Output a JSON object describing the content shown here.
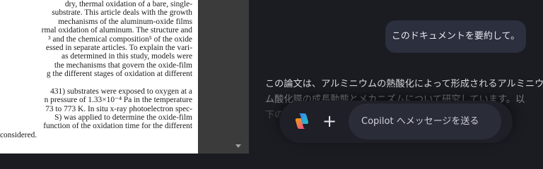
{
  "document": {
    "lines": [
      "dry, thermal oxidation of a bare, single-",
      "substrate. This article deals with the growth",
      "mechanisms of the aluminum-oxide films",
      "rmal oxidation of aluminum. The structure and",
      "³ and the chemical composition⁵ of the oxide",
      "essed in separate articles. To explain the vari-",
      "as determined in this study, models were",
      "the mechanisms that govern the oxide-film",
      "g the different stages of oxidation at different",
      "",
      "431) substrates were exposed to oxygen at a",
      "n pressure of 1.33×10⁻⁴ Pa in the temperature",
      "73 to 773 K. In situ x-ray photoelectron spec-",
      "S) was applied to determine the oxide-film",
      "function of the oxidation time for the different",
      "considered."
    ]
  },
  "chat": {
    "user_message": "このドキュメントを要約して。",
    "reply_lines": [
      "この論文は、アルミニウムの熱酸化によって形成されるアルミニウ",
      "ム酸化膜の成長動態とメカニズムについて研究しています。以",
      "下の"
    ]
  },
  "composer": {
    "placeholder": "Copilot へメッセージを送る",
    "plus_label": "+"
  },
  "colors": {
    "background": "#1b1c22",
    "bubble": "#2c2f3d",
    "input": "#2a2c38"
  }
}
